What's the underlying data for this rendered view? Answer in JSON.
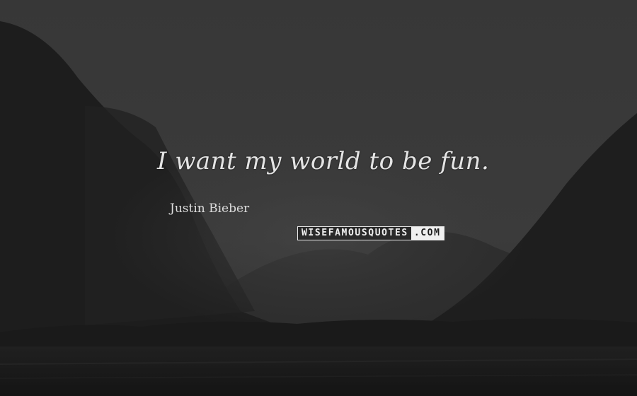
{
  "quote": {
    "text": "I want my world to be fun."
  },
  "author": {
    "name": "Justin Bieber"
  },
  "watermark": {
    "main": "WISEFAMOUSQUOTES",
    "tld": ".COM"
  },
  "colors": {
    "sky": "#3a3a3a",
    "mountain": "#1c1c1c",
    "text": "#e4e4e4"
  }
}
